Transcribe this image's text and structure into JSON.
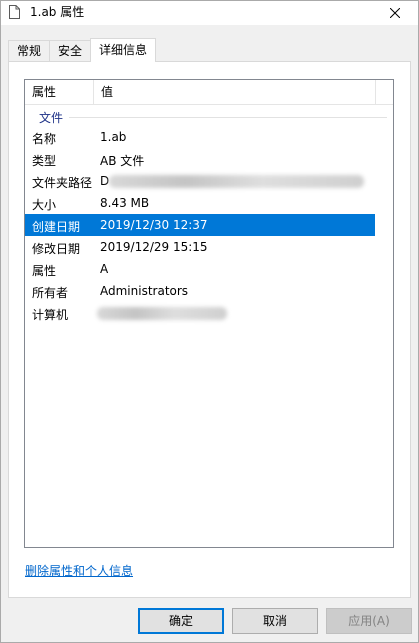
{
  "window": {
    "title": "1.ab 属性",
    "close_icon": "close-icon"
  },
  "tabs": [
    {
      "label": "常规"
    },
    {
      "label": "安全"
    },
    {
      "label": "详细信息"
    }
  ],
  "list": {
    "headers": {
      "property": "属性",
      "value": "值"
    },
    "group": "文件",
    "rows": [
      {
        "name": "名称",
        "value": "1.ab"
      },
      {
        "name": "类型",
        "value": "AB 文件"
      },
      {
        "name": "文件夹路径",
        "value": "D"
      },
      {
        "name": "大小",
        "value": "8.43 MB"
      },
      {
        "name": "创建日期",
        "value": "2019/12/30 12:37"
      },
      {
        "name": "修改日期",
        "value": "2019/12/29 15:15"
      },
      {
        "name": "属性",
        "value": "A"
      },
      {
        "name": "所有者",
        "value": "Administrators"
      },
      {
        "name": "计算机",
        "value": ""
      }
    ]
  },
  "link": "删除属性和个人信息",
  "buttons": {
    "ok": "确定",
    "cancel": "取消",
    "apply": "应用(A)"
  },
  "colors": {
    "selection": "#0078d7",
    "link": "#0066cc",
    "group": "#1e3287"
  }
}
